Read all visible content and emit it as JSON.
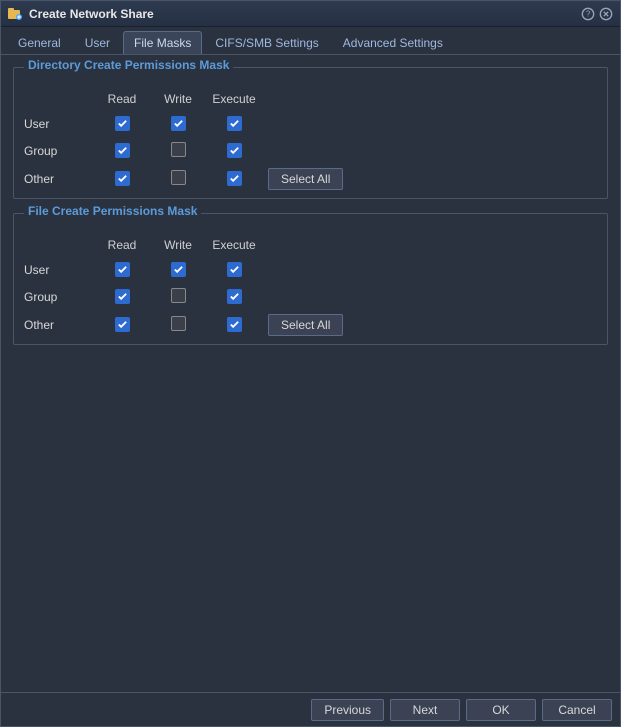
{
  "title": "Create Network Share",
  "tabs": [
    {
      "label": "General",
      "active": false
    },
    {
      "label": "User",
      "active": false
    },
    {
      "label": "File Masks",
      "active": true
    },
    {
      "label": "CIFS/SMB Settings",
      "active": false
    },
    {
      "label": "Advanced Settings",
      "active": false
    }
  ],
  "columns": {
    "read": "Read",
    "write": "Write",
    "execute": "Execute"
  },
  "rows": {
    "user": "User",
    "group": "Group",
    "other": "Other"
  },
  "dir_mask": {
    "legend": "Directory Create Permissions Mask",
    "user": {
      "read": true,
      "write": true,
      "execute": true
    },
    "group": {
      "read": true,
      "write": false,
      "execute": true
    },
    "other": {
      "read": true,
      "write": false,
      "execute": true
    },
    "select_all": "Select All"
  },
  "file_mask": {
    "legend": "File Create Permissions Mask",
    "user": {
      "read": true,
      "write": true,
      "execute": true
    },
    "group": {
      "read": true,
      "write": false,
      "execute": true
    },
    "other": {
      "read": true,
      "write": false,
      "execute": true
    },
    "select_all": "Select All"
  },
  "footer": {
    "previous": "Previous",
    "next": "Next",
    "ok": "OK",
    "cancel": "Cancel"
  }
}
